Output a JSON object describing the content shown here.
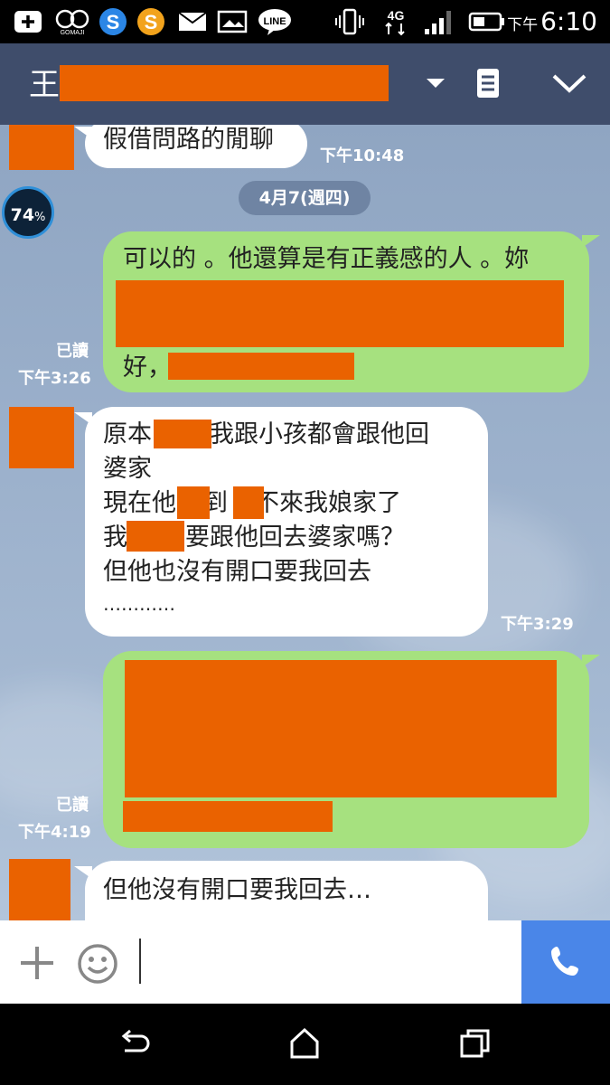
{
  "status_bar": {
    "time_prefix": "下午",
    "time": "6:10",
    "network": "4G",
    "left_icons": [
      "add-icon",
      "gomaji-icon",
      "s-app-blue-icon",
      "s-app-orange-icon",
      "mail-icon",
      "image-icon",
      "line-icon"
    ],
    "right_icons": [
      "vibrate-icon",
      "4g-icon",
      "signal-icon",
      "battery-icon"
    ]
  },
  "header": {
    "title": "王"
  },
  "chat": {
    "percent_badge": "74",
    "percent_sign": "%",
    "date_separator": "4月7(週四)",
    "messages": [
      {
        "dir": "in",
        "text": "假借問路的閒聊",
        "time": "下午10:48"
      },
      {
        "dir": "out",
        "lines": [
          "可以的 。他還算是有正義感的人 。妳",
          "好，"
        ],
        "read": "已讀",
        "time": "下午3:26"
      },
      {
        "dir": "in",
        "lines": [
          "原本",
          "我跟小孩都會跟他回",
          "婆家",
          "現在他",
          "到",
          "不來我娘家了",
          "我",
          "要跟他回去婆家嗎？",
          "但他也沒有開口要我回去",
          "…………"
        ],
        "time": "下午3:29"
      },
      {
        "dir": "out",
        "lines": [],
        "read": "已讀",
        "time": "下午4:19"
      },
      {
        "dir": "in",
        "text": "但他沒有開口要我回去…",
        "time": ""
      }
    ]
  },
  "input_bar": {
    "placeholder": ""
  },
  "colors": {
    "header_bg": "#3f4d6b",
    "outgoing_bubble": "#a6e17f",
    "incoming_bubble": "#ffffff",
    "call_button": "#4a86e8",
    "redaction": "#ea6200"
  }
}
